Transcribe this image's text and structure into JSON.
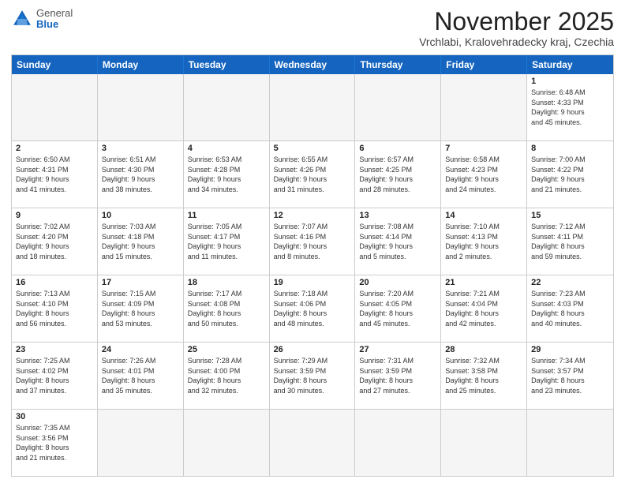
{
  "header": {
    "logo_general": "General",
    "logo_blue": "Blue",
    "month_title": "November 2025",
    "subtitle": "Vrchlabi, Kralovehradecky kraj, Czechia"
  },
  "weekdays": [
    "Sunday",
    "Monday",
    "Tuesday",
    "Wednesday",
    "Thursday",
    "Friday",
    "Saturday"
  ],
  "rows": [
    [
      {
        "day": "",
        "info": ""
      },
      {
        "day": "",
        "info": ""
      },
      {
        "day": "",
        "info": ""
      },
      {
        "day": "",
        "info": ""
      },
      {
        "day": "",
        "info": ""
      },
      {
        "day": "",
        "info": ""
      },
      {
        "day": "1",
        "info": "Sunrise: 6:48 AM\nSunset: 4:33 PM\nDaylight: 9 hours\nand 45 minutes."
      }
    ],
    [
      {
        "day": "2",
        "info": "Sunrise: 6:50 AM\nSunset: 4:31 PM\nDaylight: 9 hours\nand 41 minutes."
      },
      {
        "day": "3",
        "info": "Sunrise: 6:51 AM\nSunset: 4:30 PM\nDaylight: 9 hours\nand 38 minutes."
      },
      {
        "day": "4",
        "info": "Sunrise: 6:53 AM\nSunset: 4:28 PM\nDaylight: 9 hours\nand 34 minutes."
      },
      {
        "day": "5",
        "info": "Sunrise: 6:55 AM\nSunset: 4:26 PM\nDaylight: 9 hours\nand 31 minutes."
      },
      {
        "day": "6",
        "info": "Sunrise: 6:57 AM\nSunset: 4:25 PM\nDaylight: 9 hours\nand 28 minutes."
      },
      {
        "day": "7",
        "info": "Sunrise: 6:58 AM\nSunset: 4:23 PM\nDaylight: 9 hours\nand 24 minutes."
      },
      {
        "day": "8",
        "info": "Sunrise: 7:00 AM\nSunset: 4:22 PM\nDaylight: 9 hours\nand 21 minutes."
      }
    ],
    [
      {
        "day": "9",
        "info": "Sunrise: 7:02 AM\nSunset: 4:20 PM\nDaylight: 9 hours\nand 18 minutes."
      },
      {
        "day": "10",
        "info": "Sunrise: 7:03 AM\nSunset: 4:18 PM\nDaylight: 9 hours\nand 15 minutes."
      },
      {
        "day": "11",
        "info": "Sunrise: 7:05 AM\nSunset: 4:17 PM\nDaylight: 9 hours\nand 11 minutes."
      },
      {
        "day": "12",
        "info": "Sunrise: 7:07 AM\nSunset: 4:16 PM\nDaylight: 9 hours\nand 8 minutes."
      },
      {
        "day": "13",
        "info": "Sunrise: 7:08 AM\nSunset: 4:14 PM\nDaylight: 9 hours\nand 5 minutes."
      },
      {
        "day": "14",
        "info": "Sunrise: 7:10 AM\nSunset: 4:13 PM\nDaylight: 9 hours\nand 2 minutes."
      },
      {
        "day": "15",
        "info": "Sunrise: 7:12 AM\nSunset: 4:11 PM\nDaylight: 8 hours\nand 59 minutes."
      }
    ],
    [
      {
        "day": "16",
        "info": "Sunrise: 7:13 AM\nSunset: 4:10 PM\nDaylight: 8 hours\nand 56 minutes."
      },
      {
        "day": "17",
        "info": "Sunrise: 7:15 AM\nSunset: 4:09 PM\nDaylight: 8 hours\nand 53 minutes."
      },
      {
        "day": "18",
        "info": "Sunrise: 7:17 AM\nSunset: 4:08 PM\nDaylight: 8 hours\nand 50 minutes."
      },
      {
        "day": "19",
        "info": "Sunrise: 7:18 AM\nSunset: 4:06 PM\nDaylight: 8 hours\nand 48 minutes."
      },
      {
        "day": "20",
        "info": "Sunrise: 7:20 AM\nSunset: 4:05 PM\nDaylight: 8 hours\nand 45 minutes."
      },
      {
        "day": "21",
        "info": "Sunrise: 7:21 AM\nSunset: 4:04 PM\nDaylight: 8 hours\nand 42 minutes."
      },
      {
        "day": "22",
        "info": "Sunrise: 7:23 AM\nSunset: 4:03 PM\nDaylight: 8 hours\nand 40 minutes."
      }
    ],
    [
      {
        "day": "23",
        "info": "Sunrise: 7:25 AM\nSunset: 4:02 PM\nDaylight: 8 hours\nand 37 minutes."
      },
      {
        "day": "24",
        "info": "Sunrise: 7:26 AM\nSunset: 4:01 PM\nDaylight: 8 hours\nand 35 minutes."
      },
      {
        "day": "25",
        "info": "Sunrise: 7:28 AM\nSunset: 4:00 PM\nDaylight: 8 hours\nand 32 minutes."
      },
      {
        "day": "26",
        "info": "Sunrise: 7:29 AM\nSunset: 3:59 PM\nDaylight: 8 hours\nand 30 minutes."
      },
      {
        "day": "27",
        "info": "Sunrise: 7:31 AM\nSunset: 3:59 PM\nDaylight: 8 hours\nand 27 minutes."
      },
      {
        "day": "28",
        "info": "Sunrise: 7:32 AM\nSunset: 3:58 PM\nDaylight: 8 hours\nand 25 minutes."
      },
      {
        "day": "29",
        "info": "Sunrise: 7:34 AM\nSunset: 3:57 PM\nDaylight: 8 hours\nand 23 minutes."
      }
    ],
    [
      {
        "day": "30",
        "info": "Sunrise: 7:35 AM\nSunset: 3:56 PM\nDaylight: 8 hours\nand 21 minutes."
      },
      {
        "day": "",
        "info": ""
      },
      {
        "day": "",
        "info": ""
      },
      {
        "day": "",
        "info": ""
      },
      {
        "day": "",
        "info": ""
      },
      {
        "day": "",
        "info": ""
      },
      {
        "day": "",
        "info": ""
      }
    ]
  ]
}
